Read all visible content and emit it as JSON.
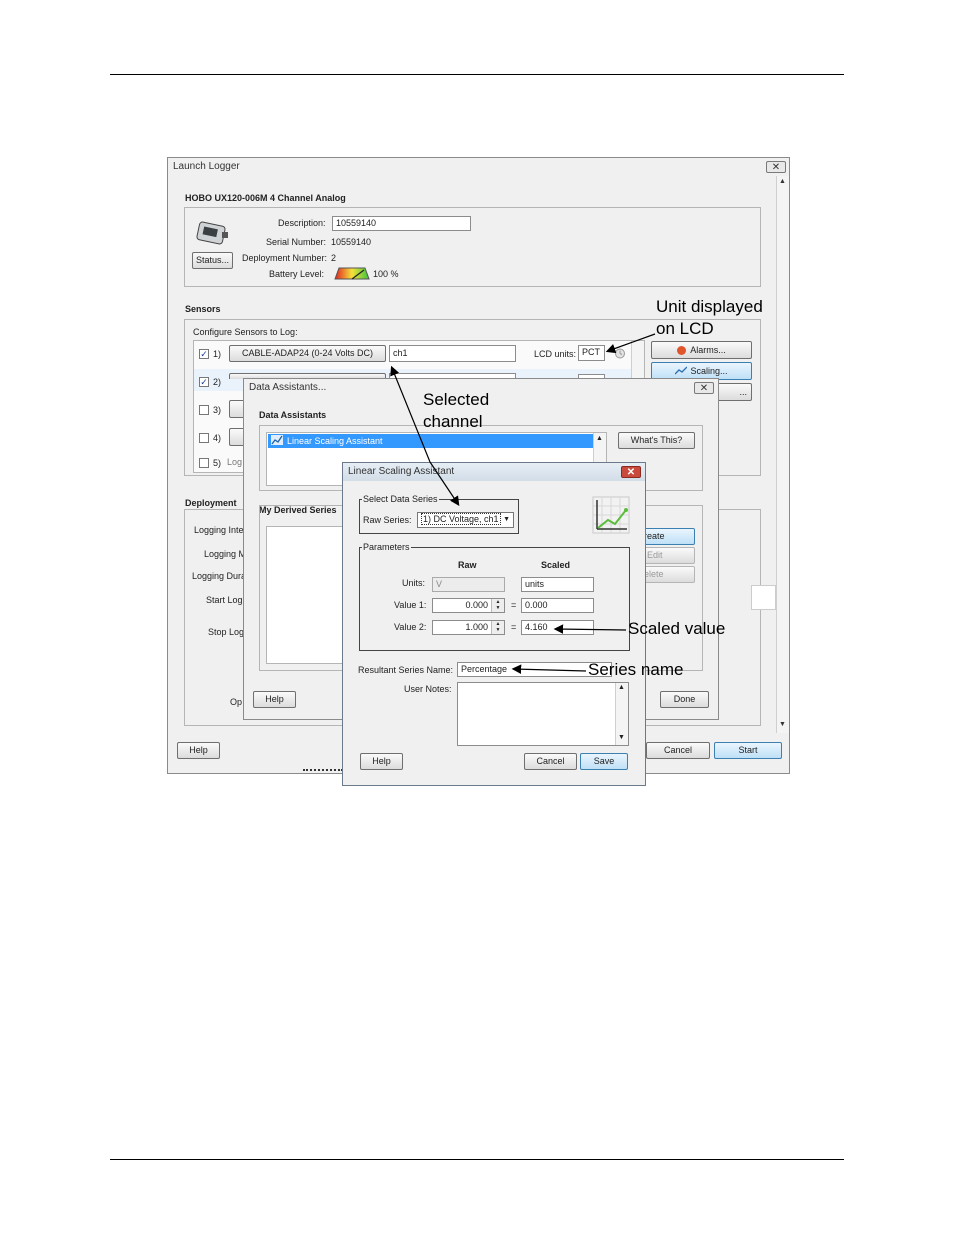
{
  "launch": {
    "title": "Launch Logger",
    "device_name": "HOBO UX120-006M 4 Channel Analog",
    "description_label": "Description:",
    "description_value": "10559140",
    "serial_label": "Serial Number:",
    "serial_value": "10559140",
    "deployment_label": "Deployment Number:",
    "deployment_value": "2",
    "battery_label": "Battery Level:",
    "battery_value": "100 %",
    "status_button": "Status...",
    "sensors_heading": "Sensors",
    "configure_label": "Configure Sensors to Log:",
    "sensors": [
      {
        "num": "1)",
        "checked": true,
        "button": "CABLE-ADAP24 (0-24 Volts DC)",
        "name": "ch1"
      },
      {
        "num": "2)",
        "checked": true
      },
      {
        "num": "3)",
        "checked": false
      },
      {
        "num": "4)",
        "checked": false
      },
      {
        "num": "5)",
        "checked": false,
        "partial": "Log"
      }
    ],
    "lcd_label": "LCD units:",
    "lcd_value": "PCT",
    "alarms_button": "Alarms...",
    "scaling_button": "Scaling...",
    "third_button_partial": "...",
    "deployment_heading": "Deployment",
    "deploy_rows": [
      "Logging Inte",
      "Logging M",
      "Logging Dura",
      "Start Log",
      "Stop Log",
      "Op"
    ],
    "help_button": "Help",
    "cancel_button": "Cancel",
    "start_button": "Start"
  },
  "assist": {
    "title": "Data Assistants...",
    "heading": "Data Assistants",
    "list_item": "Linear Scaling Assistant",
    "whats_this": "What's This?",
    "derived_heading": "My Derived Series",
    "create_button": "reate",
    "edit_button": "Edit",
    "delete_button": "elete",
    "help_button": "Help",
    "done_button": "Done"
  },
  "linear": {
    "title": "Linear Scaling Assistant",
    "select_group": "Select Data Series",
    "raw_series_label": "Raw Series:",
    "raw_series_value": "1) DC Voltage, ch1",
    "params_group": "Parameters",
    "raw_header": "Raw",
    "scaled_header": "Scaled",
    "units_label": "Units:",
    "units_raw": "V",
    "units_scaled": "units",
    "value1_label": "Value 1:",
    "value1_raw": "0.000",
    "value1_scaled": "0.000",
    "value2_label": "Value 2:",
    "value2_raw": "1.000",
    "value2_scaled": "4.160",
    "equals": "=",
    "series_name_label": "Resultant Series Name:",
    "series_name_value": "Percentage",
    "notes_label": "User Notes:",
    "help_button": "Help",
    "cancel_button": "Cancel",
    "save_button": "Save"
  },
  "annotations": {
    "unit_lcd_line1": "Unit displayed",
    "unit_lcd_line2": "on LCD",
    "selected_line1": "Selected",
    "selected_line2": "channel",
    "scaled_value": "Scaled value",
    "series_name": "Series name"
  }
}
